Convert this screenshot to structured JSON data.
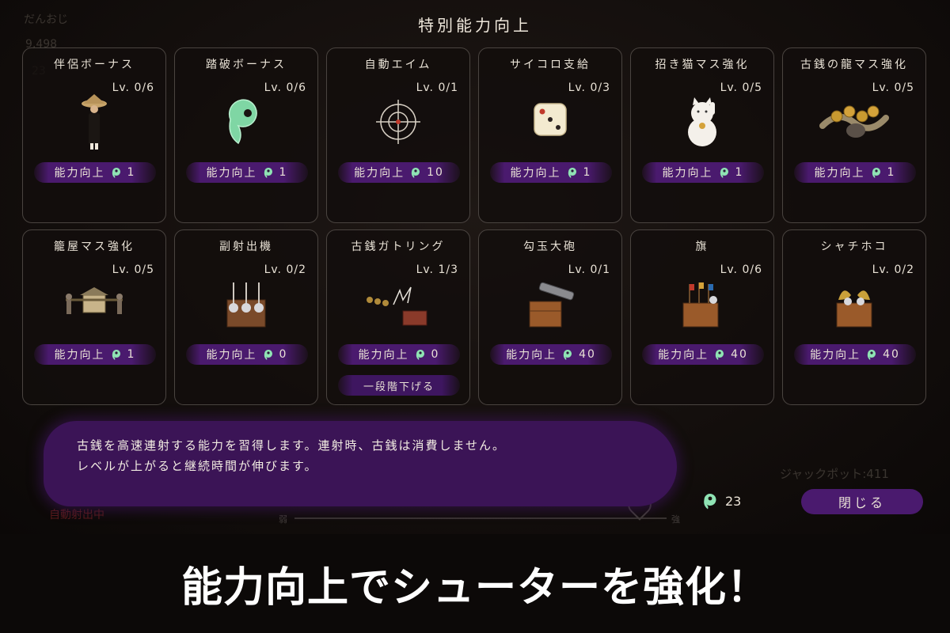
{
  "background_hud": {
    "player_name": "だんおじ",
    "coins": "9,498",
    "magatama": "23",
    "auto_fire_label": "自動射出中",
    "jackpot": "ジャックポット:411",
    "slider_left": "弱",
    "slider_right": "強"
  },
  "modal": {
    "title": "特別能力向上",
    "upgrade_label": "能力向上",
    "downgrade_label": "一段階下げる",
    "cards": [
      {
        "name": "伴侶ボーナス",
        "level": "Lv. 0/6",
        "cost": "1",
        "icon": "monk-figure-icon"
      },
      {
        "name": "踏破ボーナス",
        "level": "Lv. 0/6",
        "cost": "1",
        "icon": "jade-magatama-icon"
      },
      {
        "name": "自動エイム",
        "level": "Lv. 0/1",
        "cost": "10",
        "icon": "crosshair-icon"
      },
      {
        "name": "サイコロ支給",
        "level": "Lv. 0/3",
        "cost": "1",
        "icon": "dice-icon"
      },
      {
        "name": "招き猫マス強化",
        "level": "Lv. 0/5",
        "cost": "1",
        "icon": "maneki-neko-icon"
      },
      {
        "name": "古銭の龍マス強化",
        "level": "Lv. 0/5",
        "cost": "1",
        "icon": "coin-dragon-icon"
      },
      {
        "name": "籠屋マス強化",
        "level": "Lv. 0/5",
        "cost": "1",
        "icon": "palanquin-icon"
      },
      {
        "name": "副射出機",
        "level": "Lv. 0/2",
        "cost": "0",
        "icon": "sub-launcher-icon"
      },
      {
        "name": "古銭ガトリング",
        "level": "Lv. 1/3",
        "cost": "0",
        "icon": "coin-gatling-icon"
      },
      {
        "name": "勾玉大砲",
        "level": "Lv. 0/1",
        "cost": "40",
        "icon": "magatama-cannon-icon"
      },
      {
        "name": "旗",
        "level": "Lv. 0/6",
        "cost": "40",
        "icon": "flags-box-icon"
      },
      {
        "name": "シャチホコ",
        "level": "Lv. 0/2",
        "cost": "40",
        "icon": "shachihoko-box-icon"
      }
    ],
    "description_lines": [
      "古銭を高速連射する能力を習得します。連射時、古銭は消費しません。",
      "レベルが上がると継続時間が伸びます。"
    ],
    "magatama_count": "23",
    "close_label": "閉じる"
  },
  "banner": {
    "caption": "能力向上でシューターを強化！"
  },
  "colors": {
    "accent_purple": "#4a1a6e",
    "jade": "#8fe3b4"
  }
}
